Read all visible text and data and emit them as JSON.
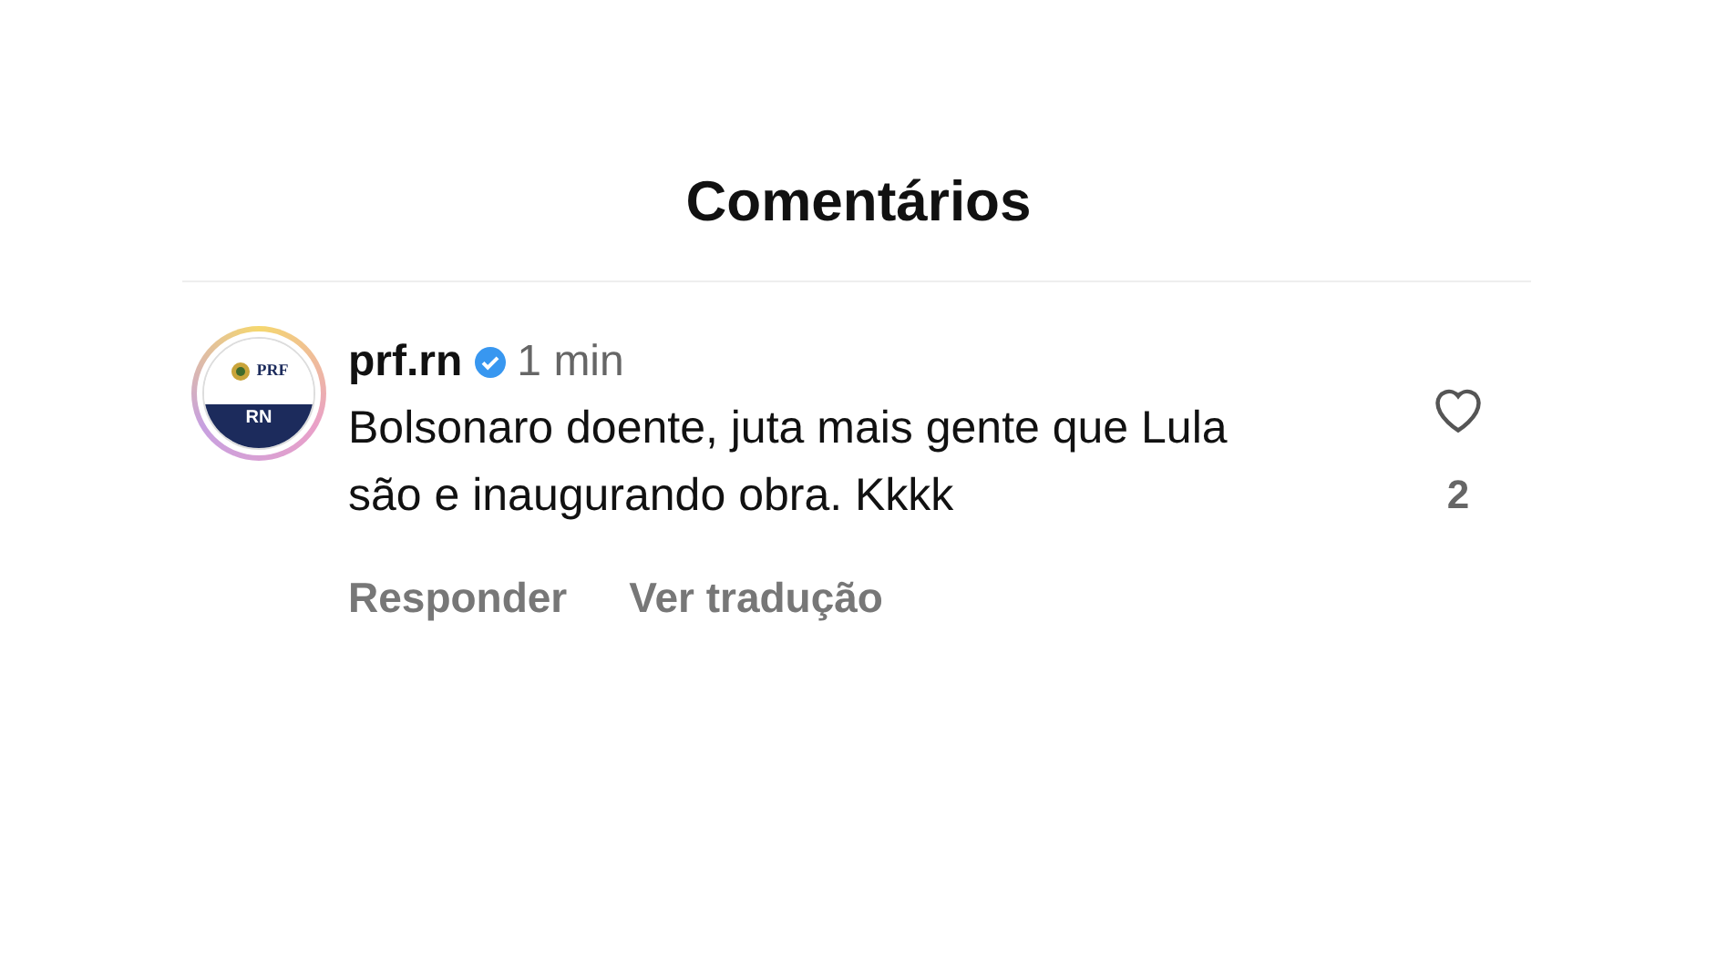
{
  "header": {
    "title": "Comentários"
  },
  "comment": {
    "avatar": {
      "top_text": "PRF",
      "bottom_text": "RN"
    },
    "username": "prf.rn",
    "verified": true,
    "time": "1 min",
    "text": "Bolsonaro doente, juta mais gente que Lula são e inaugurando obra. Kkkk",
    "liked": false,
    "like_count": "2",
    "actions": [
      "Responder",
      "Ver tradução"
    ]
  }
}
